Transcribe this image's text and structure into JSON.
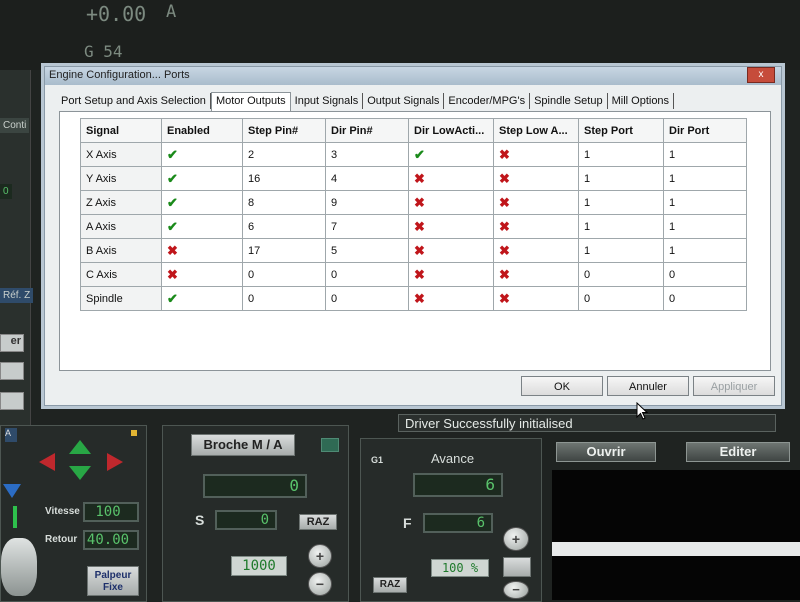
{
  "background": {
    "dro_value": "+0.00",
    "dro_unit": "A",
    "gcode_label": "G 54",
    "side_labels": [
      "Conti",
      "0",
      "Réf. Z",
      "er"
    ],
    "status_text": "Driver Successfully initialised",
    "broche_button": "Broche M / A",
    "spindle_dro": "0",
    "s_label": "S",
    "s_value": "0",
    "raz_1": "RAZ",
    "spindle_speed_value": "1000",
    "g1_label": "G1",
    "avance_label": "Avance",
    "feed_dro": "6",
    "f_label": "F",
    "f_value": "6",
    "feed_percent": "100 %",
    "raz_2": "RAZ",
    "ouvrir_button": "Ouvrir",
    "editer_button": "Editer",
    "vitesse_label": "Vitesse",
    "vitesse_value": "100",
    "retour_label": "Retour",
    "retour_value": "40.00",
    "palpeur_button": "Palpeur Fixe",
    "plus_label": "+",
    "minus_label": "−"
  },
  "dialog": {
    "title": "Engine Configuration... Ports",
    "tabs": [
      "Port Setup and Axis Selection",
      "Motor Outputs",
      "Input Signals",
      "Output Signals",
      "Encoder/MPG's",
      "Spindle Setup",
      "Mill Options"
    ],
    "active_tab": 1,
    "columns": [
      "Signal",
      "Enabled",
      "Step Pin#",
      "Dir Pin#",
      "Dir LowActi...",
      "Step Low A...",
      "Step Port",
      "Dir Port"
    ],
    "rows": [
      {
        "signal": "X Axis",
        "enabled": true,
        "step_pin": "2",
        "dir_pin": "3",
        "dir_low": true,
        "step_low": false,
        "step_port": "1",
        "dir_port": "1"
      },
      {
        "signal": "Y Axis",
        "enabled": true,
        "step_pin": "16",
        "dir_pin": "4",
        "dir_low": false,
        "step_low": false,
        "step_port": "1",
        "dir_port": "1"
      },
      {
        "signal": "Z Axis",
        "enabled": true,
        "step_pin": "8",
        "dir_pin": "9",
        "dir_low": false,
        "step_low": false,
        "step_port": "1",
        "dir_port": "1"
      },
      {
        "signal": "A Axis",
        "enabled": true,
        "step_pin": "6",
        "dir_pin": "7",
        "dir_low": false,
        "step_low": false,
        "step_port": "1",
        "dir_port": "1"
      },
      {
        "signal": "B Axis",
        "enabled": false,
        "step_pin": "17",
        "dir_pin": "5",
        "dir_low": false,
        "step_low": false,
        "step_port": "1",
        "dir_port": "1"
      },
      {
        "signal": "C Axis",
        "enabled": false,
        "step_pin": "0",
        "dir_pin": "0",
        "dir_low": false,
        "step_low": false,
        "step_port": "0",
        "dir_port": "0"
      },
      {
        "signal": "Spindle",
        "enabled": true,
        "step_pin": "0",
        "dir_pin": "0",
        "dir_low": false,
        "step_low": false,
        "step_port": "0",
        "dir_port": "0"
      }
    ],
    "ok_button": "OK",
    "cancel_button": "Annuler",
    "apply_button": "Appliquer",
    "check_glyph": "✔",
    "cross_glyph": "✖"
  }
}
